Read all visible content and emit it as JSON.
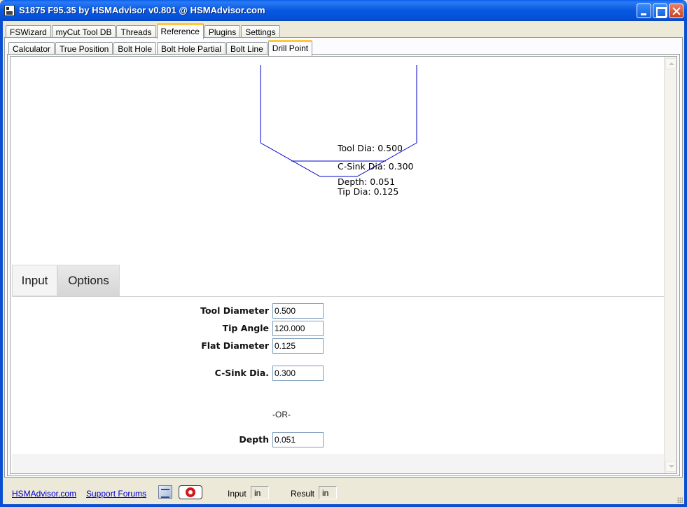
{
  "window": {
    "title": "S1875 F95.35 by HSMAdvisor v0.801 @ HSMAdvisor.com"
  },
  "main_tabs": [
    "FSWizard",
    "myCut Tool DB",
    "Threads",
    "Reference",
    "Plugins",
    "Settings"
  ],
  "main_tab_active": "Reference",
  "reference_tabs": [
    "Calculator",
    "True Position",
    "Bolt Hole",
    "Bolt Hole Partial",
    "Bolt Line",
    "Drill Point"
  ],
  "reference_tab_active": "Drill Point",
  "diagram": {
    "tool_dia": "Tool Dia: 0.500",
    "csink_dia": "C-Sink Dia: 0.300",
    "depth": "Depth: 0.051",
    "tip_dia": "Tip Dia: 0.125"
  },
  "sub_tabs": {
    "input": "Input",
    "options": "Options"
  },
  "form": {
    "tool_diameter": {
      "label": "Tool Diameter",
      "value": "0.500"
    },
    "tip_angle": {
      "label": "Tip Angle",
      "value": "120.000"
    },
    "flat_diameter": {
      "label": "Flat Diameter",
      "value": "0.125"
    },
    "csink_dia": {
      "label": "C-Sink Dia.",
      "value": "0.300"
    },
    "or_text": "-OR-",
    "depth": {
      "label": "Depth",
      "value": "0.051"
    }
  },
  "status": {
    "site_link": "HSMAdvisor.com",
    "forums_link": "Support Forums",
    "input_label": "Input",
    "input_unit": "in",
    "result_label": "Result",
    "result_unit": "in"
  },
  "colors": {
    "titlebar": "#0758E0",
    "active_tab_accent": "#FFC83C",
    "diagram_line": "#0000CC",
    "link": "#0000CC"
  },
  "icons": [
    "app-icon",
    "minimize-icon",
    "maximize-icon",
    "close-icon",
    "calculator-icon",
    "help-lifebuoy-icon"
  ]
}
